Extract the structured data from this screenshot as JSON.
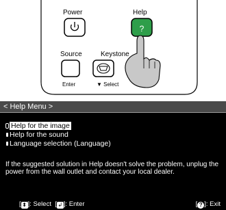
{
  "remote": {
    "power_label": "Power",
    "help_label": "Help",
    "source_label": "Source",
    "keystone_label": "Keystone",
    "enter_label": "Enter",
    "select_label": "▼ Select",
    "help_symbol": "?",
    "help_button_color": "#2e9e4a"
  },
  "menu": {
    "title": "< Help Menu >",
    "items": [
      {
        "label": "Help for the image"
      },
      {
        "label": "Help for the sound"
      },
      {
        "label": "Language selection (Language)"
      }
    ],
    "selected_index": 0,
    "description": "If the suggested solution in Help doesn't solve the problem, unplug the power from the wall outlet and contact your local dealer.",
    "footer_select": ": Select",
    "footer_enter": ": Enter",
    "footer_exit": ": Exit",
    "select_key_symbol": "⬍",
    "enter_key_symbol": "↲",
    "exit_key_symbol": "?"
  }
}
